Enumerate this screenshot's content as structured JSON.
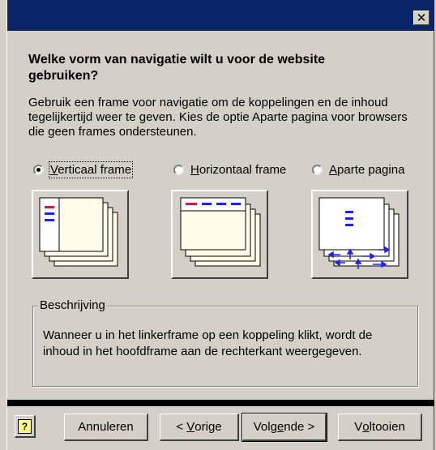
{
  "window": {
    "close_glyph": "✕"
  },
  "question": "Welke vorm van navigatie wilt u voor de website gebruiken?",
  "intro": "Gebruik een frame voor navigatie om de koppelingen en de inhoud tegelijkertijd weer te geven. Kies de optie Aparte pagina voor browsers die geen frames ondersteunen.",
  "options": [
    {
      "accel": "V",
      "rest": "erticaal frame",
      "checked": true
    },
    {
      "accel": "H",
      "rest": "orizontaal frame",
      "checked": false
    },
    {
      "accel": "A",
      "rest": "parte pagina",
      "checked": false
    }
  ],
  "description": {
    "legend": "Beschrijving",
    "text": "Wanneer u in het linkerframe op een koppeling klikt, wordt de inhoud in het hoofdframe aan de rechterkant weergegeven."
  },
  "buttons": {
    "help_icon": "help-icon",
    "help_glyph": "?",
    "cancel": "Annuleren",
    "back_pre": "< ",
    "back_accel": "V",
    "back_rest": "orige",
    "next_pre": "Volg",
    "next_accel": "e",
    "next_rest": "nde >",
    "finish_pre": "V",
    "finish_accel": "o",
    "finish_rest": "ltooien"
  },
  "colors": {
    "titlebar": "#0a246a",
    "panel": "#d4d0c8",
    "page": "#fffbe8",
    "nav_blue": "#1f1fff",
    "nav_red": "#c0204a"
  }
}
